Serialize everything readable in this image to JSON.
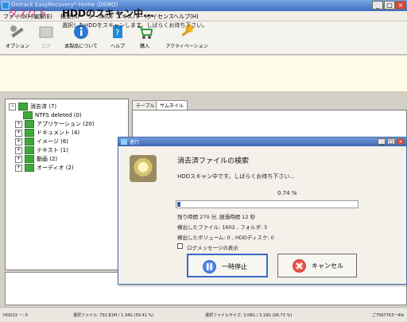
{
  "window": {
    "title": "Ontrack EasyRecovery* Home (DEMO)",
    "controls": [
      "_",
      "□",
      "×"
    ]
  },
  "menu": [
    "ファイル(F)",
    "編集(E)",
    "検索(S)",
    "ツール(O)",
    "エキスパート",
    "ライセンス",
    "ヘルプ(H)"
  ],
  "toolbar": {
    "items": [
      {
        "label": "オプション",
        "icon": "tools-icon"
      },
      {
        "label": "ログ",
        "icon": "log-icon"
      },
      {
        "label": "本製品について",
        "icon": "info-icon"
      },
      {
        "label": "ヘルプ",
        "icon": "help-book-icon"
      },
      {
        "label": "購入",
        "icon": "cart-icon"
      },
      {
        "label": "アクティベーション",
        "icon": "key-icon"
      }
    ]
  },
  "task": {
    "step": "タスク 5",
    "title": "HDDのスキャン中...",
    "subtitle": "選択したHDDをスキャンします。しばらくお待ち下さい。"
  },
  "tree": {
    "root": "消去済 (7)",
    "items": [
      "NTFS deleted (0)",
      "アプリケーション (20)",
      "ドキュメント (4)",
      "イメージ (6)",
      "テキスト (1)",
      "動画 (2)",
      "オーディオ (2)"
    ]
  },
  "tabs": [
    "テーブル",
    "サムネイル"
  ],
  "dialog": {
    "title": "進行",
    "heading": "消去済ファイルの検索",
    "message": "HDDスキャン中です。しばらくお待ち下さい...",
    "percent_text": "0.74 %",
    "progress_fraction": 0.0074,
    "lines": [
      "残り時間 270 分, 経過時間 12 秒",
      "検出したファイル: 1602 , フォルダ: 5",
      "検出したボリューム: 0 , HDDディスク: 0"
    ],
    "log_label": "ログメッセージの表示",
    "pause_label": "一時停止",
    "cancel_label": "キャンセル",
    "controls": [
      "_",
      "□",
      "×"
    ]
  },
  "status": {
    "items": [
      "HDD23 ー: 0",
      "選択ファイル: 791.81M / 1.34G (59.41 %)",
      "選択ファイルサイズ: 3.08G / 3.19G (96.73 %)",
      "ご7567763ー4fe"
    ]
  }
}
